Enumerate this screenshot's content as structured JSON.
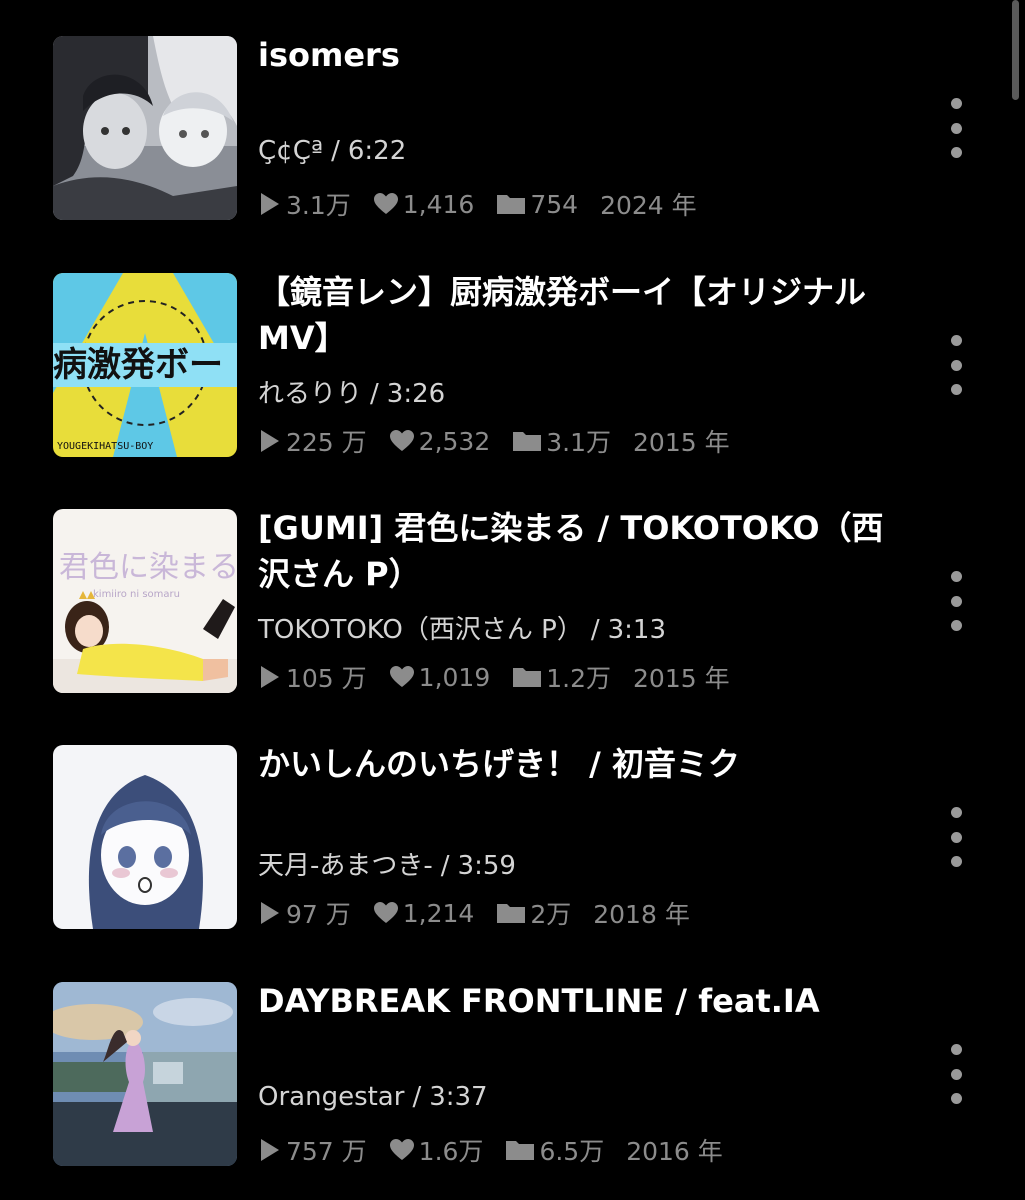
{
  "videos": [
    {
      "title": "isomers",
      "artist": "Ç¢Çª",
      "duration": "6:22",
      "views": "3.1万",
      "likes": "1,416",
      "mylists": "754",
      "year": "2024 年",
      "thumb_icon": "monochrome-illustration-two-girls"
    },
    {
      "title": "【鏡音レン】厨病激発ボーイ【オリジナル MV】",
      "artist": "れるりり",
      "duration": "3:26",
      "views": "225 万",
      "likes": "2,532",
      "mylists": "3.1万",
      "year": "2015 年",
      "thumb_icon": "cyan-yellow-title-art",
      "thumb_text": "病激発ボー",
      "thumb_subtext": "YOUGEKIHATSU-BOY"
    },
    {
      "title": "[GUMI] 君色に染まる / TOKOTOKO（西沢さん P）",
      "artist": "TOKOTOKO（西沢さん P）",
      "duration": "3:13",
      "views": "105 万",
      "likes": "1,019",
      "mylists": "1.2万",
      "year": "2015 年",
      "thumb_icon": "girl-lying-yellow-sweater",
      "thumb_text": "君色に染まる",
      "thumb_subtext": "kimiiro ni somaru"
    },
    {
      "title": "かいしんのいちげき！ / 初音ミク",
      "artist": "天月-あまつき-",
      "duration": "3:59",
      "views": "97 万",
      "likes": "1,214",
      "mylists": "2万",
      "year": "2018 年",
      "thumb_icon": "blushing-girl-sketch"
    },
    {
      "title": "DAYBREAK FRONTLINE / feat.IA",
      "artist": "Orangestar",
      "duration": "3:37",
      "views": "757 万",
      "likes": "1.6万",
      "mylists": "6.5万",
      "year": "2016 年",
      "thumb_icon": "girl-by-truck-evening-sky"
    }
  ],
  "icons": {
    "play": "play-icon",
    "like": "heart-icon",
    "mylist": "folder-icon",
    "more": "more-vertical-icon"
  },
  "colors": {
    "background": "#000000",
    "title": "#ffffff",
    "meta": "#d4d4d4",
    "stats": "#8c8c8c"
  }
}
